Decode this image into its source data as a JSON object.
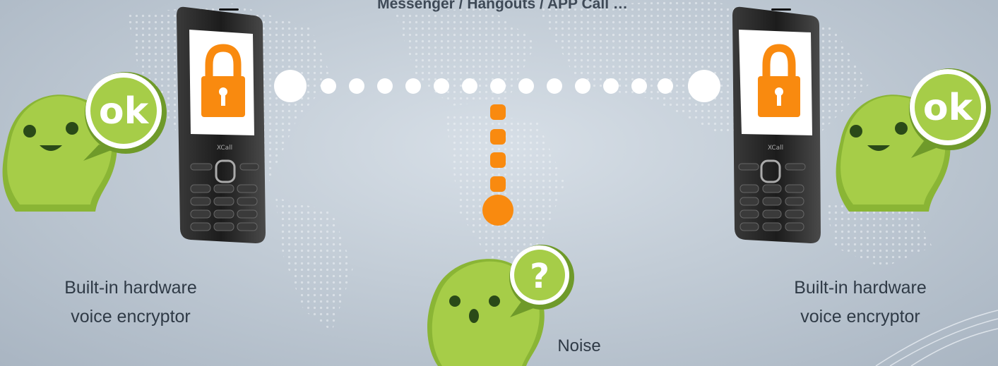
{
  "title": "Messenger / Hangouts / APP Call …",
  "left_caption": {
    "line1": "Built-in hardware",
    "line2": "voice encryptor"
  },
  "right_caption": {
    "line1": "Built-in hardware",
    "line2": "voice encryptor"
  },
  "noise_caption": "Noise",
  "ok_bubble_text": "ok",
  "question_bubble_text": "?",
  "colors": {
    "accent_orange": "#f98a0f",
    "character_green": "#a6cd48",
    "phone_body": "#252525",
    "white_dot": "#ffffff"
  },
  "icons": [
    "padlock-icon",
    "ok-speech-bubble-icon",
    "question-speech-bubble-icon"
  ]
}
